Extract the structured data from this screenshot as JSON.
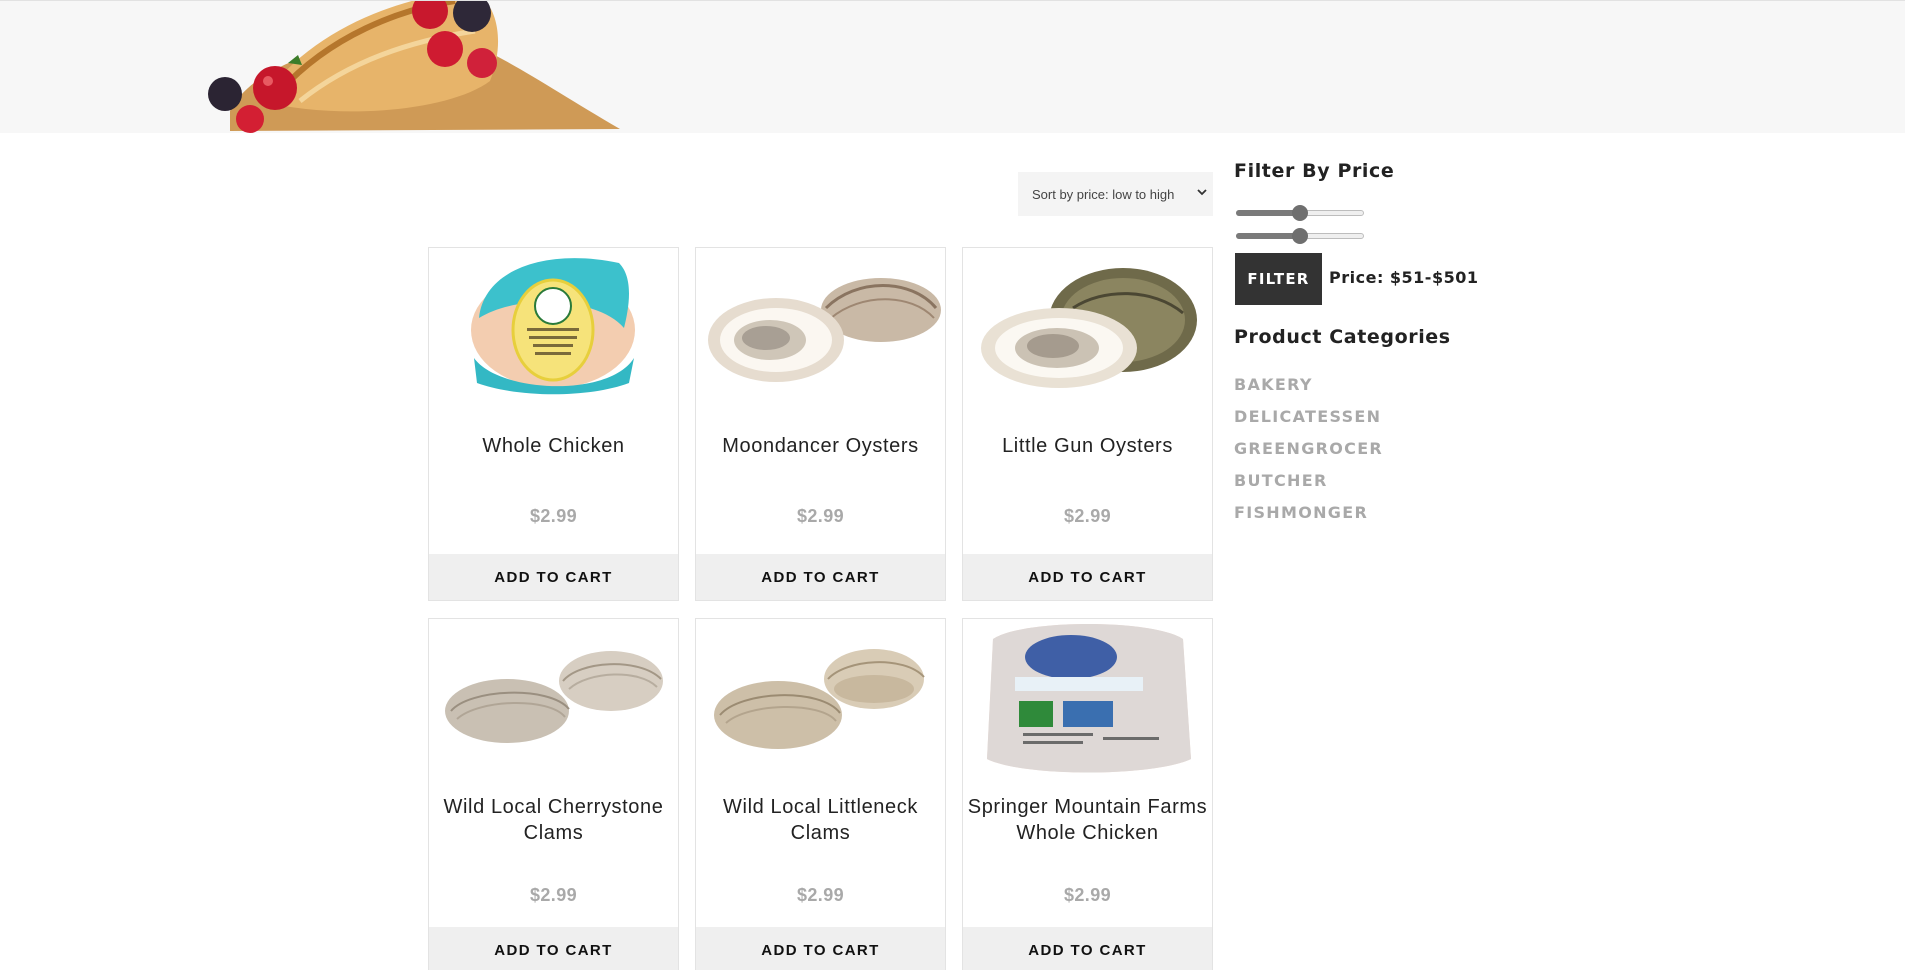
{
  "sort": {
    "selected": "Sort by price: low to high"
  },
  "products": [
    {
      "name": "Whole Chicken",
      "price": "$2.99",
      "cart_label": "ADD TO CART",
      "icon": "whole-chicken-photo"
    },
    {
      "name": "Moondancer Oysters",
      "price": "$2.99",
      "cart_label": "ADD TO CART",
      "icon": "oysters-photo"
    },
    {
      "name": "Little Gun Oysters",
      "price": "$2.99",
      "cart_label": "ADD TO CART",
      "icon": "oyster-photo"
    },
    {
      "name": "Wild Local Cherrystone Clams",
      "price": "$2.99",
      "cart_label": "ADD TO CART",
      "icon": "clams-photo"
    },
    {
      "name": "Wild Local Littleneck Clams",
      "price": "$2.99",
      "cart_label": "ADD TO CART",
      "icon": "clams-photo"
    },
    {
      "name": "Springer Mountain Farms Whole Chicken",
      "price": "$2.99",
      "cart_label": "ADD TO CART",
      "icon": "packaged-chicken-photo"
    }
  ],
  "sidebar": {
    "filter_title": "Filter By Price",
    "filter_button": "FILTER",
    "price_text": "Price: $51-$501",
    "slider_min_level": 0.5,
    "slider_max_level": 0.5,
    "categories_title": "Product Categories",
    "categories": [
      "BAKERY",
      "DELICATESSEN",
      "GREENGROCER",
      "BUTCHER",
      "FISHMONGER"
    ]
  },
  "colors": {
    "filter_button": "#333333",
    "category_text": "#a9a9a9",
    "cart_bar": "#efefef",
    "banner": "#f7f7f7"
  }
}
